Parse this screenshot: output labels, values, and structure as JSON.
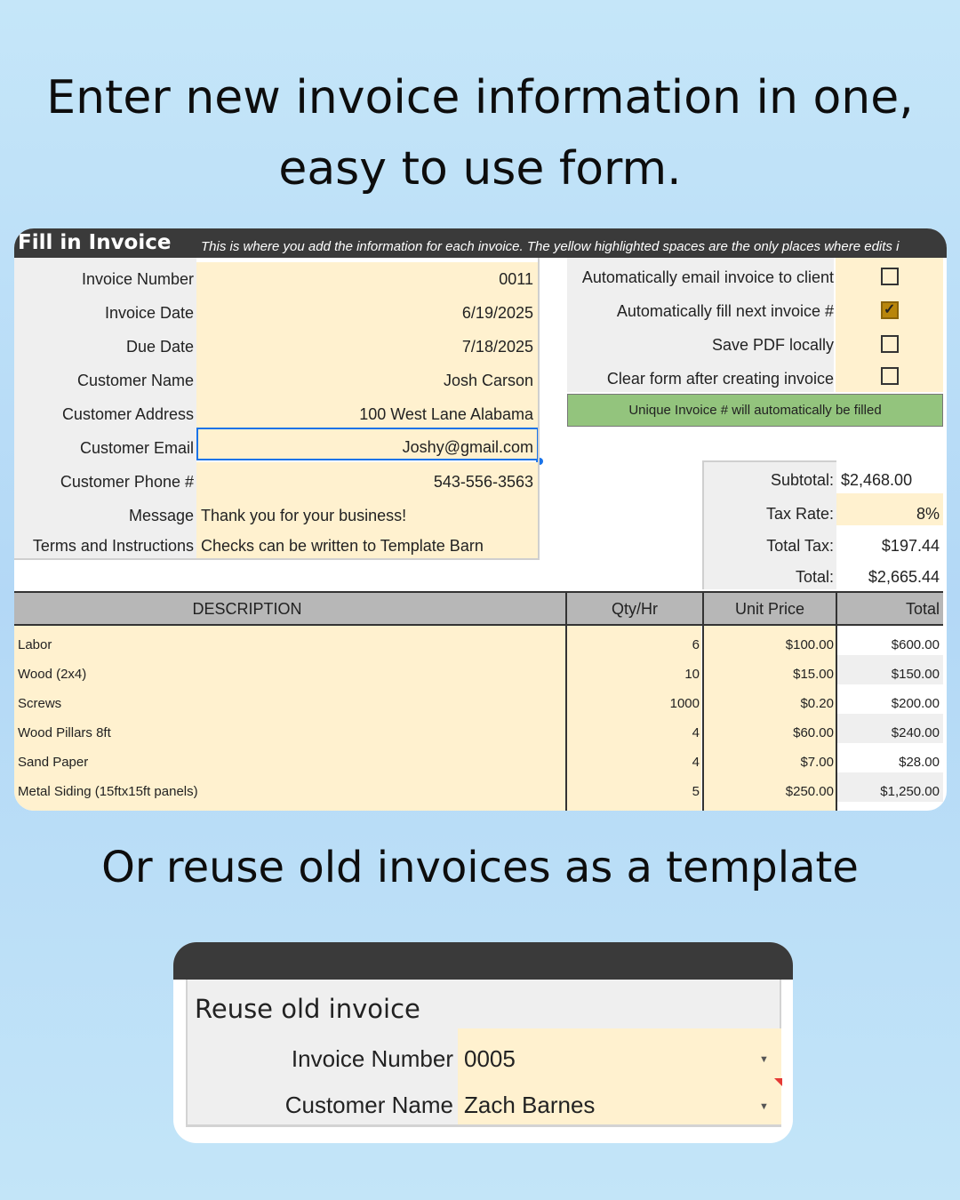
{
  "headline_top": "Enter new invoice information in one, easy to use form.",
  "headline_bottom": "Or reuse old invoices as a template",
  "invoice_form": {
    "title": "Fill in Invoice",
    "subtitle": "This is where you add the information for each invoice. The yellow highlighted spaces are the only places where edits i",
    "fields": [
      {
        "label": "Invoice Number",
        "value": "0011"
      },
      {
        "label": "Invoice Date",
        "value": "6/19/2025"
      },
      {
        "label": "Due Date",
        "value": "7/18/2025"
      },
      {
        "label": "Customer Name",
        "value": "Josh Carson"
      },
      {
        "label": "Customer Address",
        "value": "100 West Lane Alabama"
      },
      {
        "label": "Customer Email",
        "value": "Joshy@gmail.com"
      },
      {
        "label": "Customer Phone #",
        "value": "543-556-3563"
      },
      {
        "label": "Message",
        "value": "Thank you for your business!"
      },
      {
        "label": "Terms and Instructions",
        "value": "Checks can be written to Template Barn"
      }
    ],
    "options": [
      {
        "label": "Automatically email invoice to client",
        "checked": false
      },
      {
        "label": "Automatically fill next invoice #",
        "checked": true
      },
      {
        "label": "Save PDF locally",
        "checked": false
      },
      {
        "label": "Clear form after creating invoice",
        "checked": false
      }
    ],
    "notice": "Unique Invoice # will automatically be filled",
    "totals": {
      "subtotal_label": "Subtotal:",
      "subtotal": "$2,468.00",
      "tax_rate_label": "Tax Rate:",
      "tax_rate": "8%",
      "total_tax_label": "Total Tax:",
      "total_tax": "$197.44",
      "total_label": "Total:",
      "total": "$2,665.44"
    },
    "table": {
      "headers": [
        "DESCRIPTION",
        "Qty/Hr",
        "Unit Price",
        "Total"
      ],
      "rows": [
        [
          "Labor",
          "6",
          "$100.00",
          "$600.00"
        ],
        [
          "Wood (2x4)",
          "10",
          "$15.00",
          "$150.00"
        ],
        [
          "Screws",
          "1000",
          "$0.20",
          "$200.00"
        ],
        [
          "Wood Pillars 8ft",
          "4",
          "$60.00",
          "$240.00"
        ],
        [
          "Sand Paper",
          "4",
          "$7.00",
          "$28.00"
        ],
        [
          "Metal Siding (15ftx15ft panels)",
          "5",
          "$250.00",
          "$1,250.00"
        ]
      ]
    },
    "colors": {
      "header": "#3a3a3a",
      "input_fill": "#fff1cf",
      "notice": "#93c47d",
      "selection": "#1a73e8",
      "checkbox_checked": "#b8860b"
    }
  },
  "reuse_form": {
    "title": "Reuse old invoice",
    "fields": [
      {
        "label": "Invoice Number",
        "value": "0005"
      },
      {
        "label": "Customer Name",
        "value": "Zach Barnes"
      }
    ],
    "dropdown_icon": "triangle-down"
  }
}
